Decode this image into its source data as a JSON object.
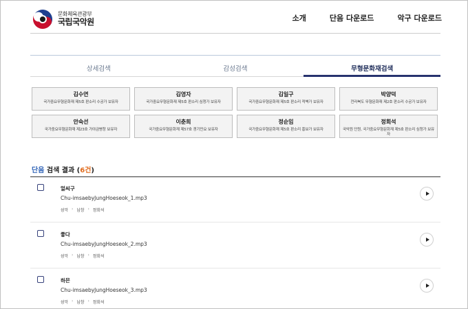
{
  "header": {
    "logo_sub": "문화체육관광부",
    "logo_main": "국립국악원",
    "nav": [
      "소개",
      "단음 다운로드",
      "악구 다운로드"
    ]
  },
  "tabs": [
    {
      "label": "상세검색",
      "active": false
    },
    {
      "label": "감성검색",
      "active": false
    },
    {
      "label": "무형문화재검색",
      "active": true
    }
  ],
  "people": [
    {
      "name": "김수연",
      "desc": "국가중요무형문화재 제5호 판소리 수궁가 보유자"
    },
    {
      "name": "김영자",
      "desc": "국가중요무형문화재 제5호 판소리 심청가 보유자"
    },
    {
      "name": "김일구",
      "desc": "국가중요무형문화재 제5호 판소리 적벽가 보유자"
    },
    {
      "name": "박양덕",
      "desc": "전라북도 무형문화재 제2호 판소리 수궁가 보유자"
    },
    {
      "name": "안숙선",
      "desc": "국가중요무형문화재 제23호 가야금병창 보유자"
    },
    {
      "name": "이춘희",
      "desc": "국가중요무형문화재 제57호 경기민요 보유자"
    },
    {
      "name": "정순임",
      "desc": "국가중요무형문화재 제5호 판소리 흥보가 보유자"
    },
    {
      "name": "정회석",
      "desc": "국악원 단원, 국가중요무형문화재 제5호 판소리 심청가 보유자"
    }
  ],
  "results": {
    "label_prefix": "단음",
    "label_middle": " 검색 결과 (",
    "count": "6건",
    "label_suffix": ")",
    "items": [
      {
        "title": "얼씨구",
        "file": "Chu-imsaebyJungHoeseok_1.mp3",
        "crumbs": [
          "성악",
          "남창",
          "정회석"
        ]
      },
      {
        "title": "좋다",
        "file": "Chu-imsaebyJungHoeseok_2.mp3",
        "crumbs": [
          "성악",
          "남창",
          "정회석"
        ]
      },
      {
        "title": "하믄",
        "file": "Chu-imsaebyJungHoeseok_3.mp3",
        "crumbs": [
          "성악",
          "남창",
          "정회석"
        ]
      }
    ]
  },
  "colors": {
    "accent_navy": "#26326e",
    "accent_blue": "#2f63b7",
    "accent_orange": "#e06a1b"
  },
  "icons": {
    "logo": "taegeuk-logo-icon",
    "play": "play-icon",
    "checkbox": "checkbox-icon"
  }
}
